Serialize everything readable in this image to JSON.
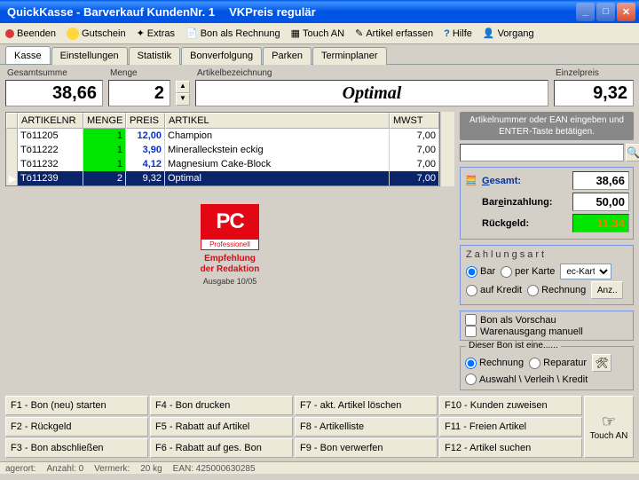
{
  "title": {
    "app": "QuickKasse - Barverkauf KundenNr. 1",
    "mode": "VKPreis regulär"
  },
  "toolbar": {
    "beenden": "Beenden",
    "gutschein": "Gutschein",
    "extras": "Extras",
    "bon_als_rechnung": "Bon als Rechnung",
    "touch_an": "Touch AN",
    "artikel_erfassen": "Artikel erfassen",
    "hilfe": "Hilfe",
    "vorgang": "Vorgang"
  },
  "tabs": [
    "Kasse",
    "Einstellungen",
    "Statistik",
    "Bonverfolgung",
    "Parken",
    "Terminplaner"
  ],
  "summary": {
    "gesamt_label": "Gesamtsumme",
    "gesamt": "38,66",
    "menge_label": "Menge",
    "menge": "2",
    "bez_label": "Artikelbezeichnung",
    "bez": "Optimal",
    "einzel_label": "Einzelpreis",
    "einzel": "9,32"
  },
  "grid": {
    "headers": {
      "artnr": "ARTIKELNR",
      "menge": "MENGE",
      "preis": "PREIS",
      "artikel": "ARTIKEL",
      "mwst": "MWST"
    },
    "rows": [
      {
        "artnr": "Tö11205",
        "menge": "1",
        "preis": "12,00",
        "artikel": "Champion",
        "mwst": "7,00"
      },
      {
        "artnr": "Tö11222",
        "menge": "1",
        "preis": "3,90",
        "artikel": "Mineralleckstein eckig",
        "mwst": "7,00"
      },
      {
        "artnr": "Tö11232",
        "menge": "1",
        "preis": "4,12",
        "artikel": "Magnesium Cake-Block",
        "mwst": "7,00"
      },
      {
        "artnr": "Tö11239",
        "menge": "2",
        "preis": "9,32",
        "artikel": "Optimal",
        "mwst": "7,00"
      }
    ]
  },
  "promo": {
    "brand": "PC",
    "sub": "Professionell",
    "line1": "Empfehlung",
    "line2": "der Redaktion",
    "issue": "Ausgabe 10/05"
  },
  "right": {
    "hint": "Artikelnummer oder EAN eingeben und ENTER-Taste betätigen.",
    "gesamt_lbl": "Gesamt:",
    "gesamt": "38,66",
    "barein_lbl": "Bareinzahlung:",
    "barein": "50,00",
    "rueck_lbl": "Rückgeld:",
    "rueck": "11,34",
    "zahlungsart_title": "Zahlungsart",
    "opt_bar": "Bar",
    "opt_perkarte": "per Karte",
    "combo_val": "ec-Karte",
    "opt_kredit": "auf Kredit",
    "opt_rechnung": "Rechnung",
    "anz_btn": "Anz..",
    "chk_vorschau": "Bon als Vorschau",
    "chk_waren": "Warenausgang manuell",
    "bon_title": "Dieser Bon ist eine......",
    "opt_rech": "Rechnung",
    "opt_rep": "Reparatur",
    "opt_avk": "Auswahl \\ Verleih \\ Kredit"
  },
  "fkeys": {
    "f1": "F1 - Bon (neu) starten",
    "f2": "F2 - Rückgeld",
    "f3": "F3 - Bon abschließen",
    "f4": "F4 - Bon drucken",
    "f5": "F5 - Rabatt auf Artikel",
    "f6": "F6 - Rabatt auf ges. Bon",
    "f7": "F7 - akt. Artikel löschen",
    "f8": "F8 - Artikelliste",
    "f9": "F9 - Bon verwerfen",
    "f10": "F10 - Kunden zuweisen",
    "f11": "F11 - Freien Artikel",
    "f12": "F12 - Artikel suchen",
    "touch": "Touch AN"
  },
  "status": {
    "lagerort": "agerort:",
    "anzahl": "Anzahl: 0",
    "vermerk": "Vermerk:",
    "kg": "20 kg",
    "ean": "EAN: 425000630285"
  }
}
